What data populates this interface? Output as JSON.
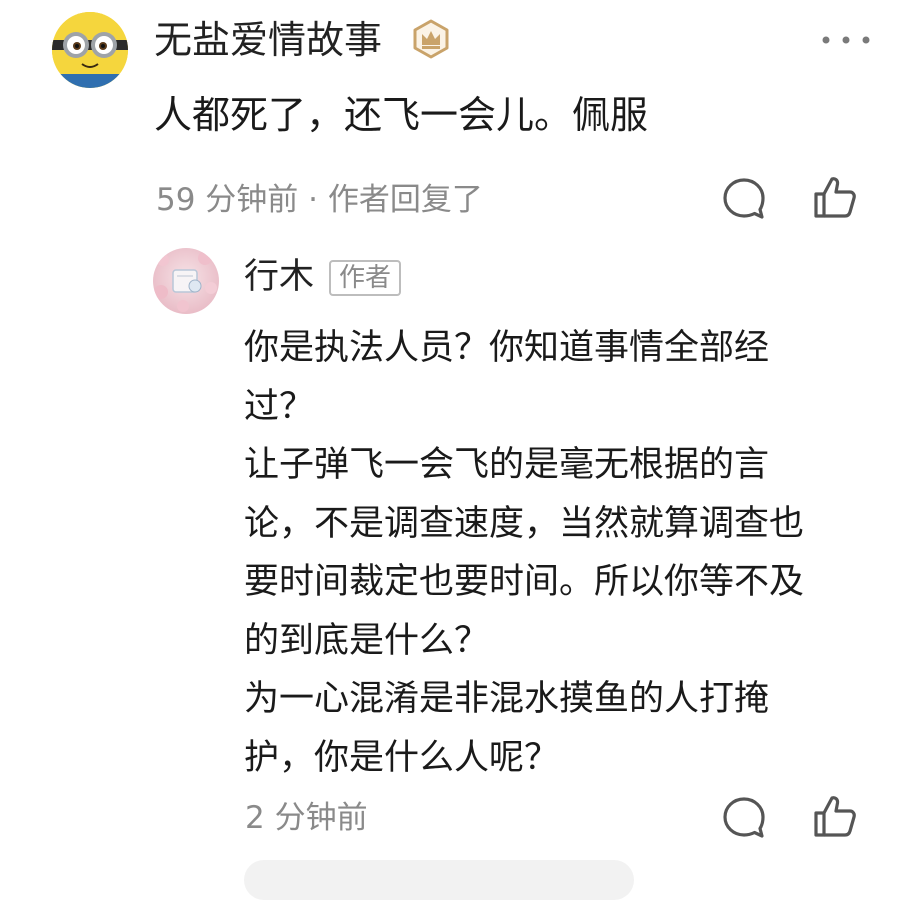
{
  "comment": {
    "username": "无盐爱情故事",
    "text": "人都死了，还飞一会儿。佩服",
    "meta": "59 分钟前 · 作者回复了",
    "icons": {
      "avatar": "minion-avatar",
      "badge": "crown-badge-icon",
      "more": "more-dots-icon",
      "reply": "reply-bubble-icon",
      "like": "thumbs-up-icon"
    }
  },
  "reply": {
    "username": "行木",
    "author_tag": "作者",
    "lines": [
      "你是执法人员？你知道事情全部经",
      "过？",
      "让子弹飞一会飞的是毫无根据的言",
      "论，不是调查速度，当然就算调查也",
      "要时间裁定也要时间。所以你等不及",
      "的到底是什么？",
      "为一心混淆是非混水摸鱼的人打掩",
      "护，你是什么人呢？"
    ],
    "meta": "2 分钟前",
    "icons": {
      "avatar": "cherry-blossom-avatar",
      "reply": "reply-bubble-icon",
      "like": "thumbs-up-icon"
    }
  },
  "colors": {
    "text": "#1a1a1a",
    "meta": "#8a8a8a",
    "badge": "#c9a36a",
    "icon": "#555555"
  }
}
